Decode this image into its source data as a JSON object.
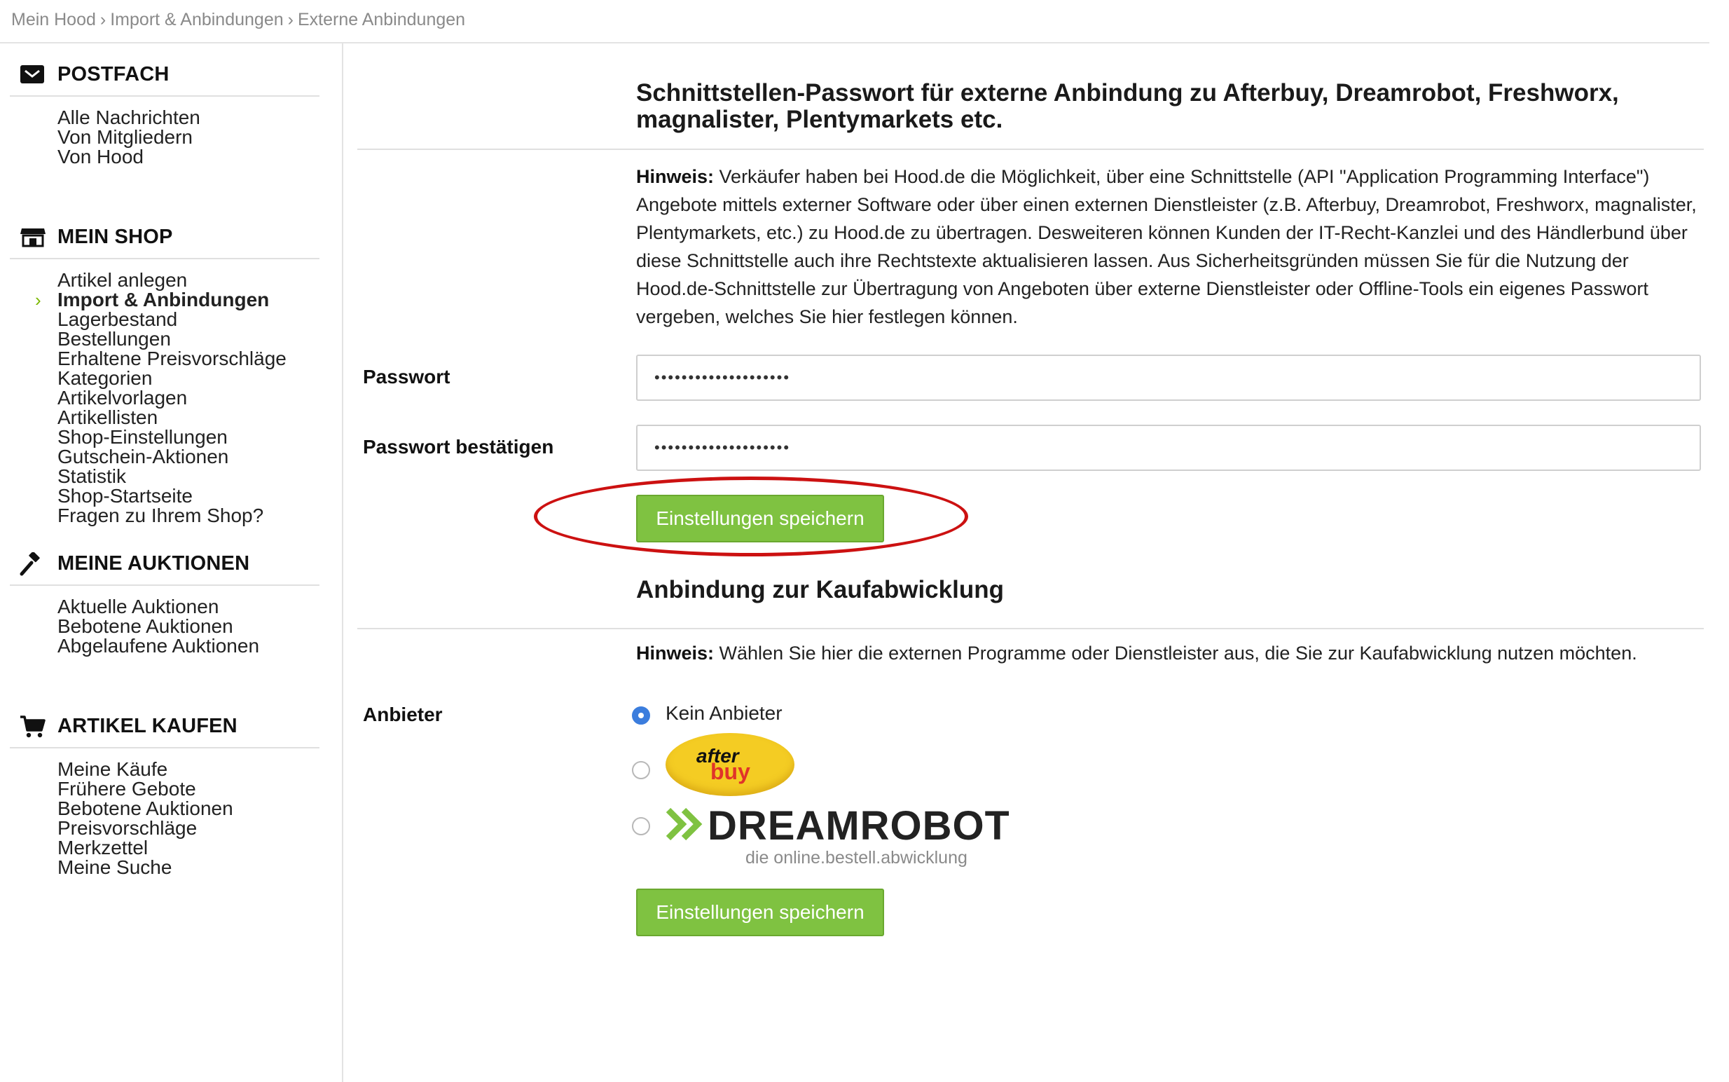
{
  "breadcrumb": [
    "Mein Hood",
    "Import & Anbindungen",
    "Externe Anbindungen"
  ],
  "breadcrumb_sep": "›",
  "sidebar": {
    "sections": [
      {
        "title": "POSTFACH",
        "icon": "envelope-icon",
        "items": [
          "Alle Nachrichten",
          "Von Mitgliedern",
          "Von Hood"
        ]
      },
      {
        "title": "MEIN SHOP",
        "icon": "shop-icon",
        "items": [
          "Artikel anlegen",
          "Import & Anbindungen",
          "Lagerbestand",
          "Bestellungen",
          "Erhaltene Preisvorschläge",
          "Kategorien",
          "Artikelvorlagen",
          "Artikellisten",
          "Shop-Einstellungen",
          "Gutschein-Aktionen",
          "Statistik",
          "Shop-Startseite",
          "Fragen zu Ihrem Shop?"
        ],
        "active_item": "Import & Anbindungen"
      },
      {
        "title": "MEINE AUKTIONEN",
        "icon": "gavel-icon",
        "items": [
          "Aktuelle Auktionen",
          "Bebotene Auktionen",
          "Abgelaufene Auktionen"
        ]
      },
      {
        "title": "ARTIKEL KAUFEN",
        "icon": "cart-icon",
        "items": [
          "Meine Käufe",
          "Frühere Gebote",
          "Bebotene Auktionen",
          "Preisvorschläge",
          "Merkzettel",
          "Meine Suche"
        ]
      }
    ]
  },
  "api_section": {
    "title": "Schnittstellen-Passwort für externe Anbindung zu Afterbuy, Dreamrobot, Freshworx, magnalister, Plentymarkets etc.",
    "hint_label": "Hinweis:",
    "hint_text": " Verkäufer haben bei Hood.de die Möglichkeit, über eine Schnittstelle (API \"Application Programming Interface\") Angebote mittels externer Software oder über einen externen Dienstleister (z.B. Afterbuy, Dreamrobot, Freshworx, magnalister, Plentymarkets, etc.) zu Hood.de zu übertragen. Desweiteren können Kunden der IT-Recht-Kanzlei und des Händlerbund über diese Schnittstelle auch ihre Rechtstexte aktualisieren lassen. Aus Sicherheitsgründen müssen Sie für die Nutzung der Hood.de-Schnittstelle zur Übertragung von Angeboten über externe Dienstleister oder Offline-Tools ein eigenes Passwort vergeben, welches Sie hier festlegen können.",
    "password_label": "Passwort",
    "password_value": "••••••••••••••••••••",
    "confirm_label": "Passwort bestätigen",
    "confirm_value": "••••••••••••••••••••",
    "save_label": "Einstellungen speichern"
  },
  "checkout_section": {
    "title": "Anbindung zur Kaufabwicklung",
    "hint_label": "Hinweis:",
    "hint_text": " Wählen Sie hier die externen Programme oder Dienstleister aus, die Sie zur Kaufabwicklung nutzen möchten.",
    "provider_label": "Anbieter",
    "options": [
      {
        "label": "Kein Anbieter",
        "checked": true
      },
      {
        "label": "afterbuy",
        "logo": "afterbuy-logo",
        "logo_text_1": "after",
        "logo_text_2": "buy",
        "checked": false
      },
      {
        "label": "DreamRobot",
        "logo": "dreamrobot-logo",
        "logo_text": "DREAMROBOT",
        "logo_sub": "die online.bestell.abwicklung",
        "checked": false
      }
    ],
    "save_label": "Einstellungen speichern"
  },
  "colors": {
    "accent_green": "#7fc241",
    "highlight_red": "#cc1111",
    "radio_blue": "#3b7ddd"
  }
}
